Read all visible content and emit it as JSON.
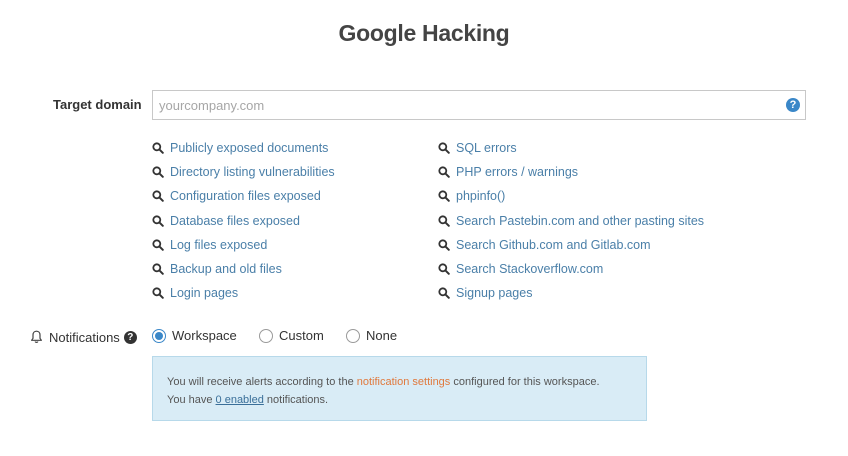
{
  "title": "Google Hacking",
  "target": {
    "label": "Target domain",
    "placeholder": "yourcompany.com",
    "value": "",
    "help_glyph": "?"
  },
  "dorks_left": [
    "Publicly exposed documents",
    "Directory listing vulnerabilities",
    "Configuration files exposed",
    "Database files exposed",
    "Log files exposed",
    "Backup and old files",
    "Login pages"
  ],
  "dorks_right": [
    "SQL errors",
    "PHP errors / warnings",
    "phpinfo()",
    "Search Pastebin.com and other pasting sites",
    "Search Github.com and Gitlab.com",
    "Search Stackoverflow.com",
    "Signup pages"
  ],
  "notifications": {
    "label": "Notifications",
    "help_glyph": "?",
    "options": [
      "Workspace",
      "Custom",
      "None"
    ],
    "selected": "Workspace"
  },
  "info": {
    "line1_pre": "You will receive alerts according to the ",
    "line1_link": "notification settings",
    "line1_post": " configured for this workspace.",
    "line2_pre": "You have ",
    "line2_link": "0 enabled",
    "line2_post": " notifications."
  },
  "colors": {
    "link": "#4a7fa8",
    "accent": "#3a87c8",
    "info_bg": "#d9ecf6",
    "orange_link": "#e0793d"
  },
  "icons": {
    "dork": "search-icon",
    "help": "question-circle-icon",
    "notifications": "bell-icon"
  }
}
